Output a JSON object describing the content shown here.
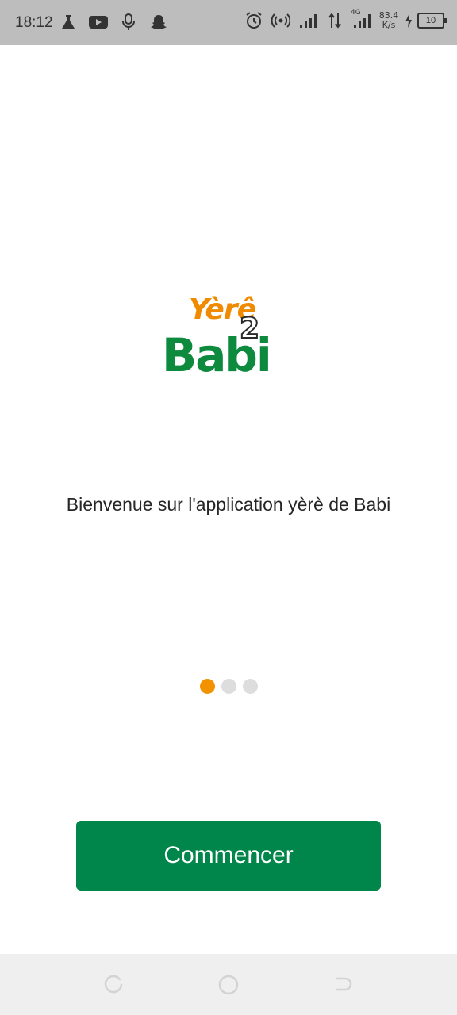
{
  "status_bar": {
    "time": "18:12",
    "left_icons": [
      "flask-icon",
      "youtube-icon",
      "microphone-icon",
      "snapchat-icon"
    ],
    "right_icons": [
      "alarm-icon",
      "hotspot-icon",
      "signal-icon",
      "data-transfer-icon",
      "signal-4g-icon"
    ],
    "network_label": "4G",
    "net_speed_value": "83.4",
    "net_speed_unit": "K/s",
    "battery_level": "10"
  },
  "logo": {
    "yere": "Yèrê",
    "number": "2",
    "babi": "Babi"
  },
  "onboarding": {
    "welcome_text": "Bienvenue sur l'application yèrè de Babi",
    "page_index": 1,
    "page_count": 3,
    "cta_label": "Commencer"
  },
  "colors": {
    "primary_green": "#00854a",
    "accent_orange": "#f39200",
    "inactive_dot": "#dddddd",
    "status_bar_bg": "#bdbdbd"
  },
  "nav_bar": {
    "buttons": [
      "recents-icon",
      "home-icon",
      "back-icon"
    ]
  }
}
